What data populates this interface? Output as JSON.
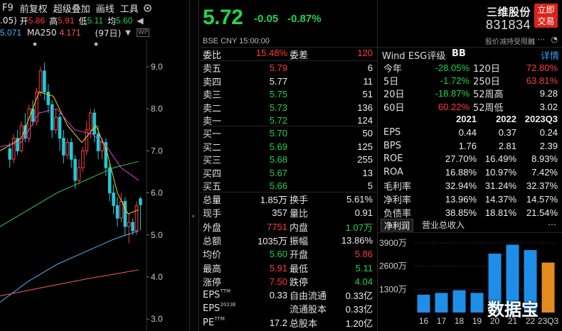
{
  "toolbar": {
    "f9": "F9",
    "adjust": "前复权",
    "overlay": "超级叠加",
    "draw": "画线",
    "tools": "工具",
    "gear_icon": "gear-icon"
  },
  "kline_info": {
    "ma_prefix": ".05)",
    "open_label": "开",
    "open_value": "5.86",
    "high_label": "高",
    "high_value": "5.91",
    "low_label": "低",
    "low_value": "5.11",
    "avg_label": "均",
    "avg_value": "5.60",
    "ma_left": "5.071",
    "ma250_label": "MA250",
    "ma250_value": "4.171",
    "period": "(97日)"
  },
  "kline_axis": {
    "ticks": [
      "9.0",
      "8.0",
      "7.0",
      "6.0",
      "5.0",
      "4.0",
      "3.0"
    ]
  },
  "quote": {
    "price": "5.72",
    "change": "-0.05",
    "change_pct": "-0.87%",
    "exchange_line": "BSE  CNY  15:00:00",
    "name": "三维股份",
    "code": "831834",
    "trade_button": [
      "立即",
      "交易"
    ],
    "note": "股价减持受限",
    "note_mark": "融"
  },
  "order_book": {
    "weibi_label": "委比",
    "weibi_value": "15.48%",
    "weicha_label": "委差",
    "weicha_value": "120",
    "asks": [
      {
        "label": "卖五",
        "price": "5.79",
        "vol": "6",
        "color": "red"
      },
      {
        "label": "卖四",
        "price": "5.77",
        "vol": "11",
        "color": "white"
      },
      {
        "label": "卖三",
        "price": "5.75",
        "vol": "51",
        "color": "green"
      },
      {
        "label": "卖二",
        "price": "5.73",
        "vol": "136",
        "color": "green"
      },
      {
        "label": "卖一",
        "price": "5.72",
        "vol": "124",
        "color": "green"
      }
    ],
    "bids": [
      {
        "label": "买一",
        "price": "5.70",
        "vol": "50",
        "color": "green"
      },
      {
        "label": "买二",
        "price": "5.69",
        "vol": "125",
        "color": "green"
      },
      {
        "label": "买三",
        "price": "5.68",
        "vol": "255",
        "color": "green"
      },
      {
        "label": "买四",
        "price": "5.67",
        "vol": "13",
        "color": "green"
      },
      {
        "label": "买五",
        "price": "5.66",
        "vol": "5",
        "color": "green"
      }
    ]
  },
  "stats": [
    {
      "l1": "总量",
      "v1": "1.85万",
      "c1": "white",
      "l2": "换手",
      "v2": "5.61%",
      "c2": "white"
    },
    {
      "l1": "现手",
      "v1": "357",
      "c1": "white",
      "l2": "量比",
      "v2": "0.91",
      "c2": "white"
    },
    {
      "l1": "外盘",
      "v1": "7751",
      "c1": "red",
      "l2": "内盘",
      "v2": "1.07万",
      "c2": "green"
    },
    {
      "l1": "总额",
      "v1": "1035万",
      "c1": "white",
      "l2": "振幅",
      "v2": "13.86%",
      "c2": "white"
    },
    {
      "l1": "均价",
      "v1": "5.60",
      "c1": "green",
      "l2": "开盘",
      "v2": "5.86",
      "c2": "red"
    },
    {
      "l1": "最高",
      "v1": "5.91",
      "c1": "red",
      "l2": "最低",
      "v2": "5.11",
      "c2": "green"
    },
    {
      "l1": "涨停",
      "v1": "7.50",
      "c1": "red",
      "l2": "跌停",
      "v2": "4.04",
      "c2": "green"
    },
    {
      "l1": "EPS",
      "sup": "TTM",
      "v1": "0.33",
      "c1": "white",
      "l2": "自由流通",
      "v2": "0.33亿",
      "c2": "white"
    },
    {
      "l1": "EPS",
      "sup": "2023E",
      "v1": "",
      "c1": "white",
      "l2": "流通股本",
      "v2": "0.33亿",
      "c2": "white"
    },
    {
      "l1": "PE",
      "sup": "TTM",
      "v1": "17.2",
      "c1": "white",
      "l2": "总股本",
      "v2": "1.20亿",
      "c2": "white"
    }
  ],
  "esg": {
    "label": "Wind ESG评级",
    "rating": "BB",
    "detail": "详情"
  },
  "returns": [
    {
      "l1": "今年",
      "v1": "-28.05%",
      "c1": "green",
      "l2": "120日",
      "v2": "72.80%",
      "c2": "red"
    },
    {
      "l1": "5日",
      "v1": "-1.72%",
      "c1": "green",
      "l2": "250日",
      "v2": "63.81%",
      "c2": "red"
    },
    {
      "l1": "20日",
      "v1": "-18.87%",
      "c1": "green",
      "l2": "52周高",
      "v2": "9.28",
      "c2": "white"
    },
    {
      "l1": "60日",
      "v1": "60.22%",
      "c1": "red",
      "l2": "52周低",
      "v2": "3.02",
      "c2": "white"
    }
  ],
  "fin": {
    "headers": [
      "2021",
      "2022",
      "2023Q3"
    ],
    "rows": [
      {
        "label": "EPS",
        "values": [
          "0.44",
          "0.37",
          "0.24"
        ]
      },
      {
        "label": "BPS",
        "values": [
          "1.76",
          "2.81",
          "2.39"
        ]
      },
      {
        "label": "ROE",
        "values": [
          "27.70%",
          "16.49%",
          "8.93%"
        ]
      },
      {
        "label": "ROA",
        "values": [
          "16.88%",
          "10.97%",
          "7.42%"
        ]
      },
      {
        "label": "毛利率",
        "values": [
          "32.94%",
          "31.24%",
          "32.37%"
        ]
      },
      {
        "label": "净利率",
        "values": [
          "13.96%",
          "14.37%",
          "14.57%"
        ]
      },
      {
        "label": "负债率",
        "values": [
          "38.85%",
          "18.81%",
          "21.54%"
        ]
      }
    ]
  },
  "tabs": {
    "active": "净利润",
    "other": "营业总收入"
  },
  "watermark": "数据宝",
  "chart_data": [
    {
      "type": "bar",
      "categories": [
        "16",
        "17",
        "18",
        "19",
        "20",
        "21",
        "22",
        "23Q3"
      ],
      "values": [
        1000,
        1100,
        1250,
        1100,
        3300,
        3800,
        3500,
        2800
      ],
      "ylim": [
        0,
        3900
      ],
      "yticks": [
        "3900万",
        "2600万",
        "1300万"
      ],
      "colors": [
        "#1e8ee8",
        "#1e8ee8",
        "#1e8ee8",
        "#1e8ee8",
        "#1e8ee8",
        "#1e8ee8",
        "#1e8ee8",
        "#e58a1f"
      ]
    }
  ]
}
